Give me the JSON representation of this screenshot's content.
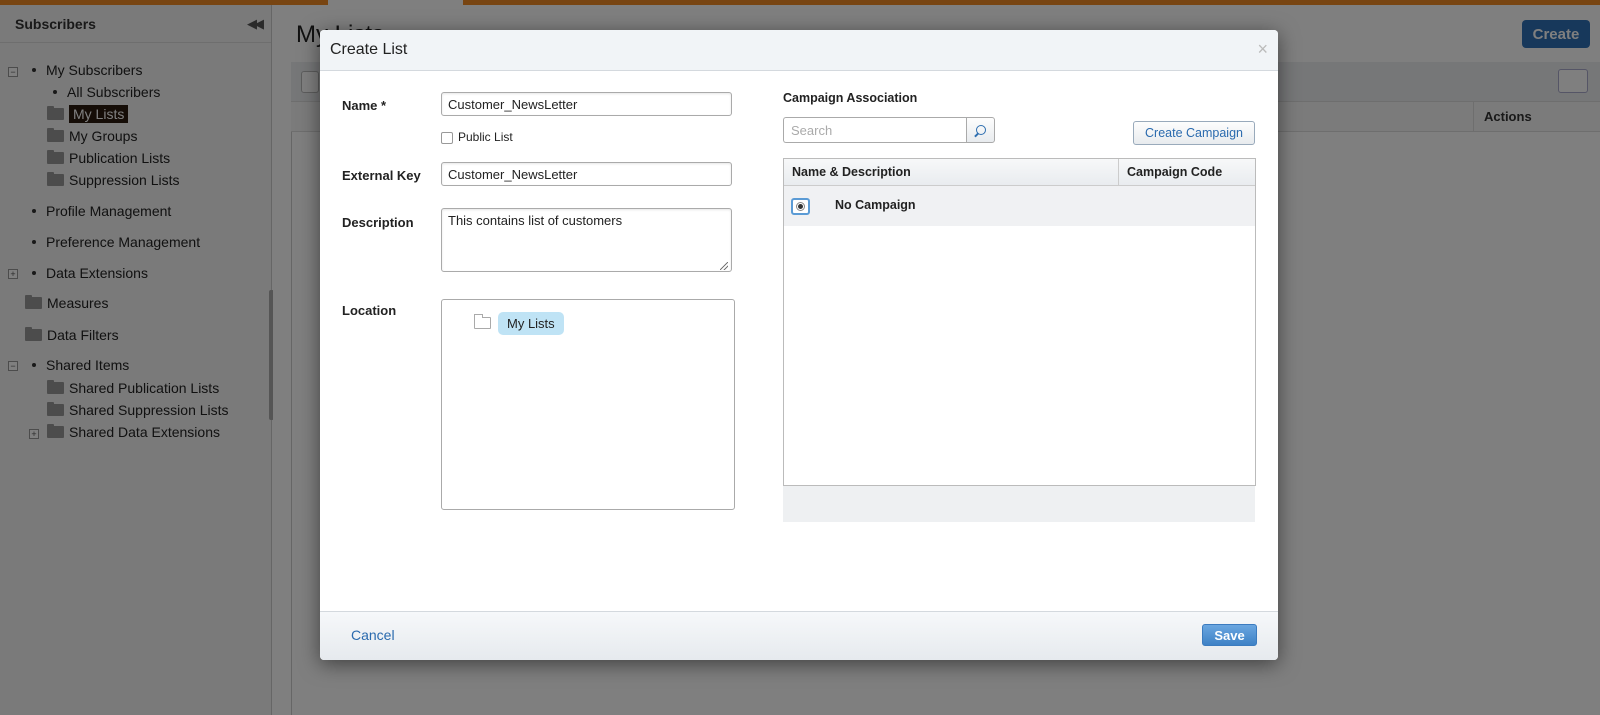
{
  "sidebar": {
    "title": "Subscribers",
    "items": {
      "my_subscribers": "My Subscribers",
      "all_subscribers": "All Subscribers",
      "my_lists": "My Lists",
      "my_groups": "My Groups",
      "publication_lists": "Publication Lists",
      "suppression_lists": "Suppression Lists",
      "profile_management": "Profile Management",
      "preference_management": "Preference Management",
      "data_extensions": "Data Extensions",
      "measures": "Measures",
      "data_filters": "Data Filters",
      "shared_items": "Shared Items",
      "shared_publication_lists": "Shared Publication Lists",
      "shared_suppression_lists": "Shared Suppression Lists",
      "shared_data_extensions": "Shared Data Extensions"
    }
  },
  "main": {
    "title": "My Lists",
    "create_label": "Create",
    "actions_header": "Actions"
  },
  "modal": {
    "title": "Create List",
    "close_glyph": "×",
    "name_label": "Name *",
    "name_value": "Customer_NewsLetter",
    "public_list_label": "Public List",
    "public_list_checked": false,
    "external_key_label": "External Key",
    "external_key_value": "Customer_NewsLetter",
    "description_label": "Description",
    "description_value": "This contains list of customers",
    "location_label": "Location",
    "location_node": "My Lists",
    "campaign": {
      "section_label": "Campaign Association",
      "search_placeholder": "Search",
      "create_button": "Create Campaign",
      "columns": [
        "Name & Description",
        "Campaign Code"
      ],
      "rows": [
        {
          "name": "No Campaign",
          "code": "",
          "selected": true
        }
      ]
    },
    "cancel_label": "Cancel",
    "save_label": "Save"
  },
  "colors": {
    "accent_orange": "#f08a24",
    "primary_blue": "#2f71b7",
    "selection_blue": "#bfe3f5"
  }
}
